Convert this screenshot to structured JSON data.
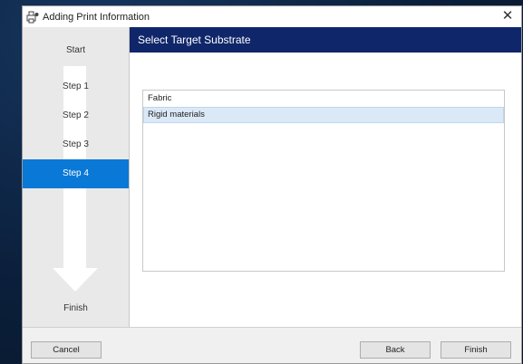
{
  "window": {
    "title": "Adding Print Information",
    "close_glyph": "✕",
    "icon": "printer-icon"
  },
  "sidebar": {
    "steps": [
      {
        "label": "Start",
        "active": false
      },
      {
        "label": "Step 1",
        "active": false
      },
      {
        "label": "Step 2",
        "active": false
      },
      {
        "label": "Step 3",
        "active": false
      },
      {
        "label": "Step 4",
        "active": true
      },
      {
        "label": "Finish",
        "active": false
      }
    ]
  },
  "content": {
    "header": "Select Target Substrate",
    "list": {
      "items": [
        {
          "label": "Fabric",
          "selected": false
        },
        {
          "label": "Rigid materials",
          "selected": true
        }
      ]
    }
  },
  "footer": {
    "cancel_label": "Cancel",
    "back_label": "Back",
    "finish_label": "Finish"
  },
  "colors": {
    "header_bg": "#10266a",
    "active_step": "#0a78d7",
    "selection": "#dbe9f7"
  }
}
